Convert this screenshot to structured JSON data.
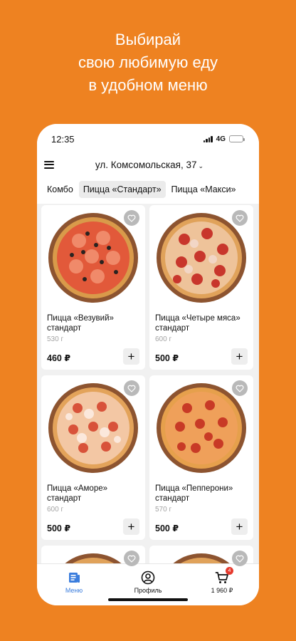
{
  "promo": {
    "line1": "Выбирай",
    "line2": "свою любимую еду",
    "line3": "в удобном меню"
  },
  "status_bar": {
    "time": "12:35",
    "network": "4G"
  },
  "header": {
    "address": "ул. Комсомольская, 37"
  },
  "tabs": [
    {
      "label": "Комбо",
      "active": false
    },
    {
      "label": "Пицца «Стандарт»",
      "active": true
    },
    {
      "label": "Пицца «Макси»",
      "active": false
    }
  ],
  "products": [
    {
      "name": "Пицца «Везувий» стандарт",
      "weight": "530 г",
      "price": "460 ₽"
    },
    {
      "name": "Пицца «Четыре мяса» стандарт",
      "weight": "600 г",
      "price": "500 ₽"
    },
    {
      "name": "Пицца «Аморе» стандарт",
      "weight": "600 г",
      "price": "500 ₽"
    },
    {
      "name": "Пицца «Пепперони» стандарт",
      "weight": "570 г",
      "price": "500 ₽"
    }
  ],
  "bottom_nav": {
    "menu_label": "Меню",
    "profile_label": "Профиль",
    "cart_label": "1 960 ₽",
    "cart_count": "4"
  },
  "icons": {
    "favorite": "heart-icon",
    "add": "plus-icon",
    "menu": "hamburger-icon",
    "nav_menu": "menu-list-icon",
    "nav_profile": "profile-icon",
    "nav_cart": "cart-icon"
  },
  "colors": {
    "background": "#ee8221",
    "accent": "#3b7ddd",
    "badge": "#e63a2e"
  }
}
